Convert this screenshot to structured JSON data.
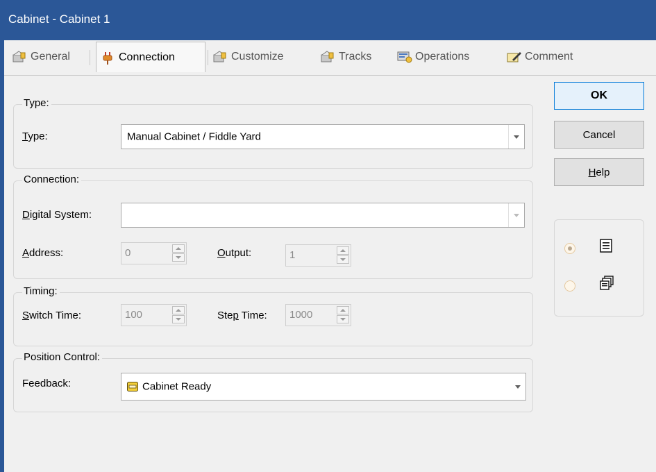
{
  "window": {
    "title": "Cabinet - Cabinet 1"
  },
  "tabs": [
    {
      "label": "General",
      "icon": "general-icon",
      "active": false
    },
    {
      "label": "Connection",
      "icon": "plug-icon",
      "active": true
    },
    {
      "label": "Customize",
      "icon": "customize-icon",
      "active": false
    },
    {
      "label": "Tracks",
      "icon": "tracks-icon",
      "active": false
    },
    {
      "label": "Operations",
      "icon": "operations-icon",
      "active": false
    },
    {
      "label": "Comment",
      "icon": "comment-icon",
      "active": false
    }
  ],
  "type_group": {
    "title": "Type:",
    "type_label_first": "T",
    "type_label_rest": "ype:",
    "type_value": "Manual Cabinet / Fiddle Yard"
  },
  "connection_group": {
    "title": "Connection:",
    "digital_system_label_first": "D",
    "digital_system_label_rest": "igital System:",
    "digital_system_value": "",
    "address_label_first": "A",
    "address_label_rest": "ddress:",
    "address_value": "0",
    "output_label_first": "O",
    "output_label_rest": "utput:",
    "output_value": "1"
  },
  "timing_group": {
    "title": "Timing:",
    "switch_time_label_first": "S",
    "switch_time_label_rest": "witch Time:",
    "switch_time_value": "100",
    "step_time_label_pre": "Ste",
    "step_time_label_u": "p",
    "step_time_label_post": " Time:",
    "step_time_value": "1000"
  },
  "position_group": {
    "title": "Position Control:",
    "feedback_label": "Feedback:",
    "feedback_value": "Cabinet Ready",
    "feedback_icon": "feedback-sensor-icon",
    "feedback_icon_color": "#e8c020"
  },
  "buttons": {
    "ok": "OK",
    "cancel": "Cancel",
    "help_first": "H",
    "help_rest": "elp"
  },
  "view_options": [
    {
      "icon": "list-view-icon",
      "selected": true
    },
    {
      "icon": "multi-window-icon",
      "selected": false
    }
  ],
  "colors": {
    "titlebar": "#2b5797",
    "accent": "#0078d7"
  }
}
